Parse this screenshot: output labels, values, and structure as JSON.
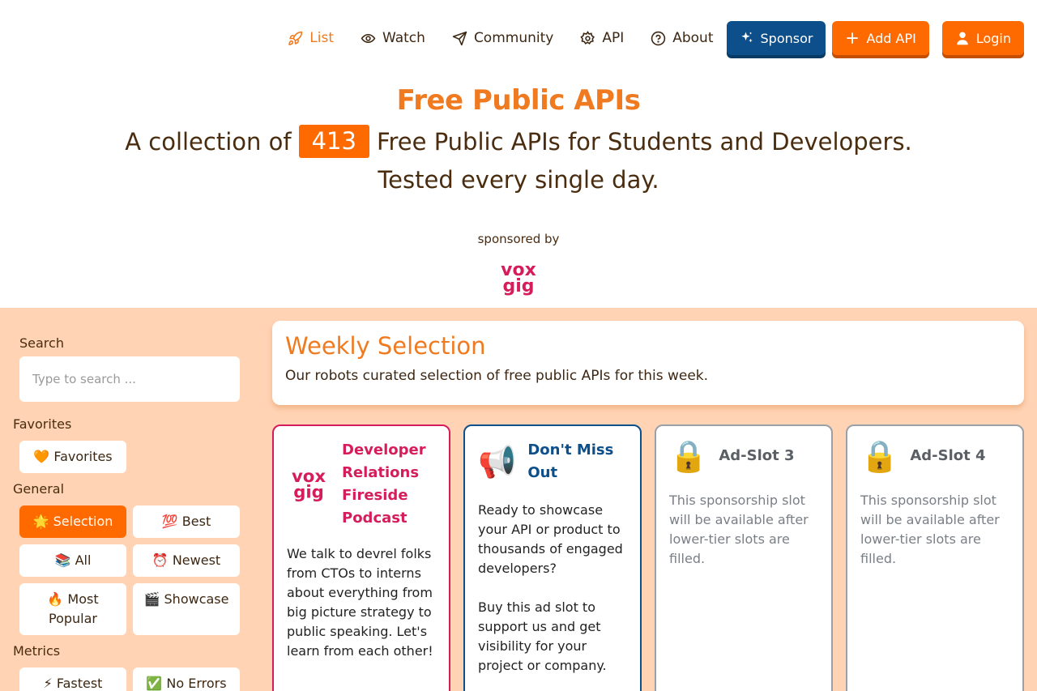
{
  "nav": {
    "links": [
      {
        "label": "List"
      },
      {
        "label": "Watch"
      },
      {
        "label": "Community"
      },
      {
        "label": "API"
      },
      {
        "label": "About"
      }
    ],
    "sponsor_label": "Sponsor",
    "add_api_label": "Add API",
    "login_label": "Login"
  },
  "hero": {
    "title": "Free Public APIs",
    "sub_prefix": "A collection of",
    "count": "413",
    "sub_suffix": "Free Public APIs for Students and Developers.",
    "sub2": "Tested every single day.",
    "sponsored_by": "sponsored by",
    "sponsor_logo_text": "voxgig"
  },
  "sidebar": {
    "search_label": "Search",
    "search_placeholder": "Type to search ...",
    "favorites_label": "Favorites",
    "favorites_chip": "🧡 Favorites",
    "general_label": "General",
    "general": [
      "🌟 Selection",
      "💯 Best",
      "📚 All",
      "⏰ Newest",
      "🔥 Most Popular",
      "🎬 Showcase"
    ],
    "metrics_label": "Metrics",
    "metrics": [
      "⚡ Fastest",
      "✅ No Errors"
    ]
  },
  "weekly": {
    "title": "Weekly Selection",
    "desc": "Our robots curated selection of free public APIs for this week."
  },
  "cards": [
    {
      "title": "Developer Relations Fireside Podcast",
      "body": "We talk to devrel folks from CTOs to interns about everything from big picture strategy to public speaking. Let's learn from each other!"
    },
    {
      "icon": "📢",
      "title": "Don't Miss Out",
      "body": "Ready to showcase your API or product to thousands of engaged developers?\n\nBuy this ad slot to support us and get visibility for your project or company.\n\nPrices Double For Each"
    },
    {
      "icon": "🔒",
      "title": "Ad-Slot 3",
      "body": "This sponsorship slot will be available after lower-tier slots are filled."
    },
    {
      "icon": "🔒",
      "title": "Ad-Slot 4",
      "body": "This sponsorship slot will be available after lower-tier slots are filled."
    }
  ],
  "colors": {
    "accent": "#ff6a00",
    "brand_blue": "#0c4f8a",
    "voxgig": "#d61d5b",
    "panel_bg": "#ffd3b4"
  }
}
